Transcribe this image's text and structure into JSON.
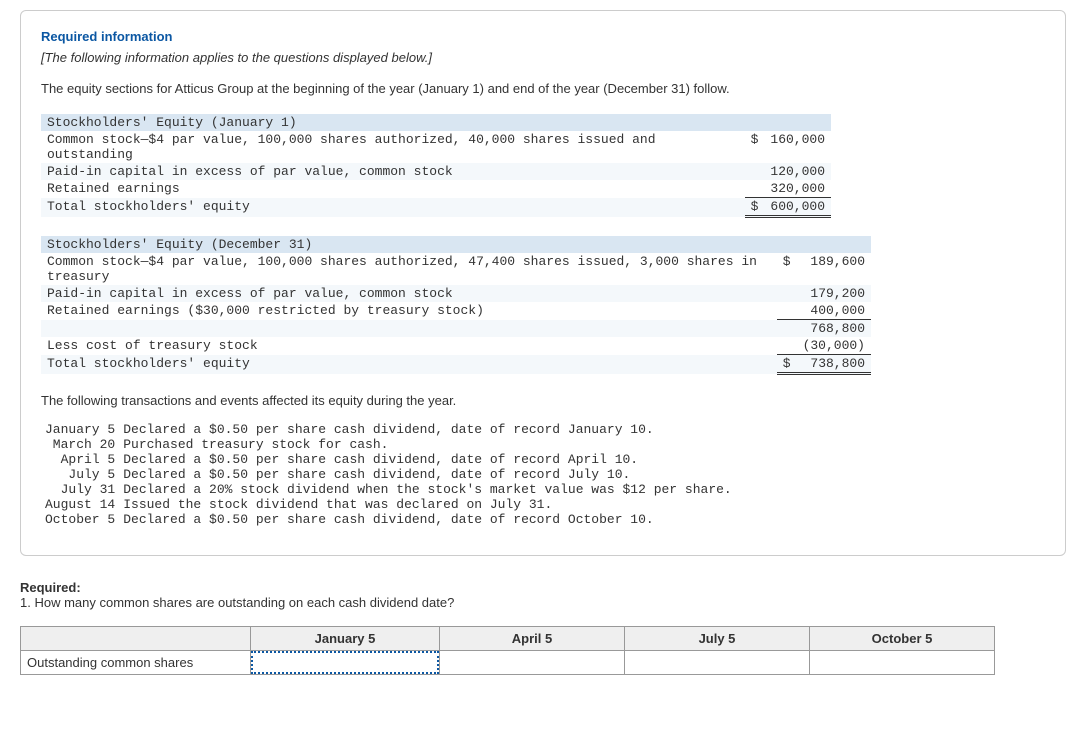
{
  "header": {
    "required_info": "Required information",
    "italic_note": "[The following information applies to the questions displayed below.]",
    "intro": "The equity sections for Atticus Group at the beginning of the year (January 1) and end of the year (December 31) follow."
  },
  "equity_jan": {
    "title": "Stockholders' Equity (January 1)",
    "rows": [
      {
        "label": "Common stock—$4 par value, 100,000 shares authorized, 40,000 shares issued and outstanding",
        "dollar": "$",
        "amt": "160,000"
      },
      {
        "label": "Paid-in capital in excess of par value, common stock",
        "dollar": "",
        "amt": "120,000"
      },
      {
        "label": "Retained earnings",
        "dollar": "",
        "amt": "320,000"
      }
    ],
    "total": {
      "label": "Total stockholders' equity",
      "dollar": "$",
      "amt": "600,000"
    }
  },
  "equity_dec": {
    "title": "Stockholders' Equity (December 31)",
    "rows": [
      {
        "label": "Common stock—$4 par value, 100,000 shares authorized, 47,400 shares issued, 3,000 shares in treasury",
        "dollar": "$",
        "amt": "189,600"
      },
      {
        "label": "Paid-in capital in excess of par value, common stock",
        "dollar": "",
        "amt": "179,200"
      },
      {
        "label": "Retained earnings ($30,000 restricted by treasury stock)",
        "dollar": "",
        "amt": "400,000"
      }
    ],
    "subtotal": {
      "label": "",
      "dollar": "",
      "amt": "768,800"
    },
    "less": {
      "label": "Less cost of treasury stock",
      "dollar": "",
      "amt": "(30,000)"
    },
    "total": {
      "label": "Total stockholders' equity",
      "dollar": "$",
      "amt": "738,800"
    }
  },
  "transactions": {
    "intro": "The following transactions and events affected its equity during the year.",
    "rows": [
      {
        "date": "January 5",
        "desc": "Declared a $0.50 per share cash dividend, date of record January 10."
      },
      {
        "date": "March 20",
        "desc": "Purchased treasury stock for cash."
      },
      {
        "date": "April 5",
        "desc": "Declared a $0.50 per share cash dividend, date of record April 10."
      },
      {
        "date": "July 5",
        "desc": "Declared a $0.50 per share cash dividend, date of record July 10."
      },
      {
        "date": "July 31",
        "desc": "Declared a 20% stock dividend when the stock's market value was $12 per share."
      },
      {
        "date": "August 14",
        "desc": "Issued the stock dividend that was declared on July 31."
      },
      {
        "date": "October 5",
        "desc": "Declared a $0.50 per share cash dividend, date of record October 10."
      }
    ]
  },
  "required": {
    "label": "Required:",
    "q1": "1. How many common shares are outstanding on each cash dividend date?"
  },
  "answer_grid": {
    "row_label": "Outstanding common shares",
    "headers": [
      "January 5",
      "April 5",
      "July 5",
      "October 5"
    ]
  }
}
